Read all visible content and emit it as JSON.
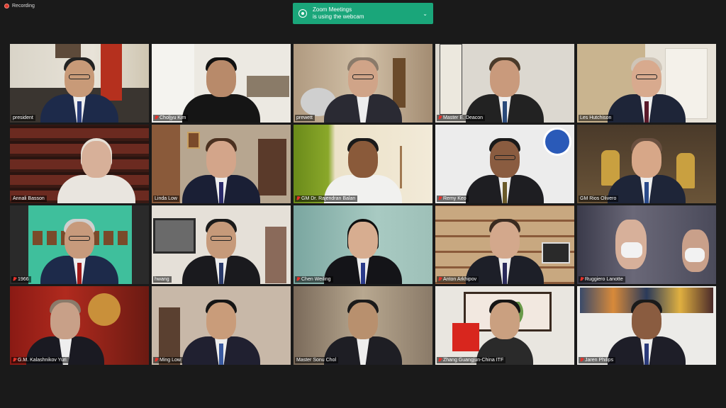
{
  "recording": {
    "label": "Recording"
  },
  "notification": {
    "line1": "Zoom Meetings",
    "line2": "is using the webcam"
  },
  "participants": [
    {
      "name": "president",
      "muted": false
    },
    {
      "name": "Choljyu Kim",
      "muted": true
    },
    {
      "name": "prewett",
      "muted": false
    },
    {
      "name": "Master E. Deacon",
      "muted": true
    },
    {
      "name": "Les Hutchison",
      "muted": false
    },
    {
      "name": "Annali Basson",
      "muted": false
    },
    {
      "name": "Linda Low",
      "muted": false,
      "active": true
    },
    {
      "name": "GM Dr. Rajendran Balan",
      "muted": true
    },
    {
      "name": "Remy Keo",
      "muted": true
    },
    {
      "name": "GM Rios Olivero",
      "muted": false
    },
    {
      "name": "1966",
      "muted": true
    },
    {
      "name": "hwang",
      "muted": false
    },
    {
      "name": "Chen Weiling",
      "muted": true
    },
    {
      "name": "Anton Arkhipov",
      "muted": true
    },
    {
      "name": "Ruggiero Lanotte",
      "muted": true
    },
    {
      "name": "G.M. Kalashnikov Yuri",
      "muted": true
    },
    {
      "name": "Ming Low",
      "muted": true
    },
    {
      "name": "Master Sonu Chol",
      "muted": false
    },
    {
      "name": "Zhang Guangjun-China ITF",
      "muted": true
    },
    {
      "name": "Jaren Philips",
      "muted": true
    }
  ],
  "colors": {
    "notification": "#1aa67a",
    "active_border": "#c6d86a",
    "muted_mic": "#e5322b"
  }
}
